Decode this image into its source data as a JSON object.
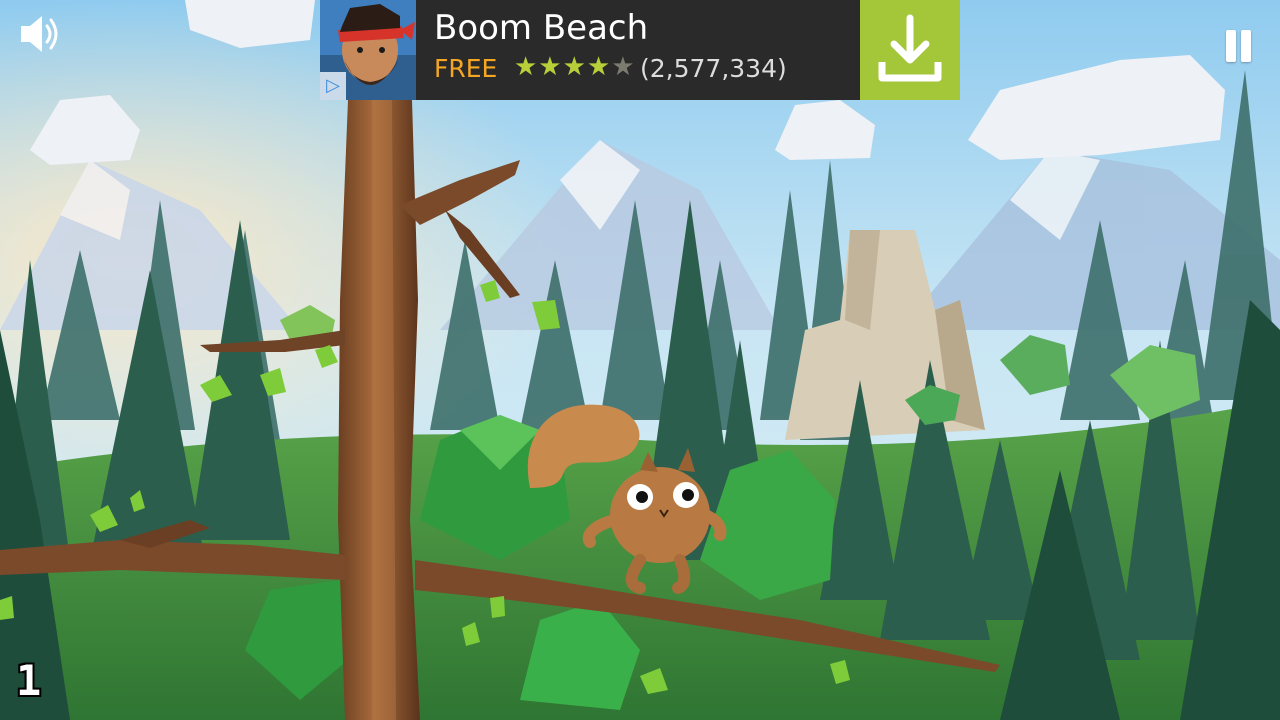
{
  "ad": {
    "app_name": "Boom Beach",
    "price": "FREE",
    "rating": 4.5,
    "stars_filled": "★★★★",
    "stars_half": "★",
    "stars_empty": "",
    "review_count": "(2,577,334)",
    "adchoices_glyph": "▷",
    "download_icon": "download-icon",
    "accent_color": "#a4c639",
    "price_color": "#f5a623"
  },
  "hud": {
    "score": "1",
    "sound_icon": "speaker-icon",
    "pause_icon": "pause-icon"
  },
  "scene": {
    "characters": [
      "squirrel"
    ],
    "sky_color": "#a9d6ef",
    "grass_color": "#3f8f3a"
  }
}
